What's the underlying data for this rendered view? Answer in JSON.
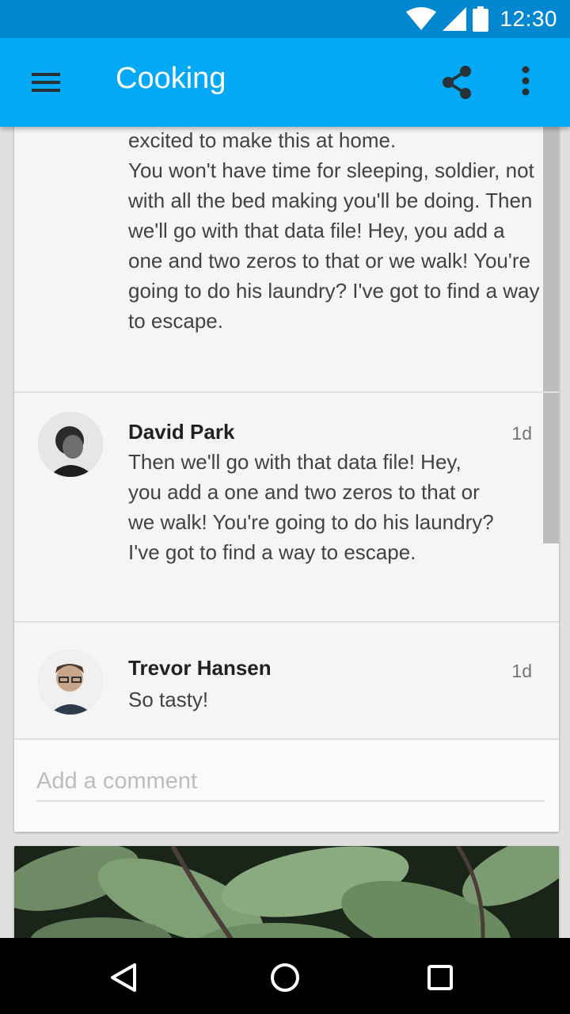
{
  "status_bar": {
    "time": "12:30",
    "icons": [
      "wifi-icon",
      "signal-icon",
      "battery-icon"
    ]
  },
  "app_bar": {
    "title": "Cooking",
    "color": "#03A9F4",
    "status_color": "#0288D1",
    "actions": [
      "menu-icon",
      "share-icon",
      "more-vert-icon"
    ]
  },
  "card": {
    "partial_comment": {
      "text": "excited to make this at home.\nYou won't have time for sleeping, soldier, not with all the bed making you'll be doing. Then we'll go with that data file! Hey, you add a one and two zeros to that or we walk! You're going to do his laundry? I've got to find a way to escape."
    },
    "comments": [
      {
        "author": "David Park",
        "time": "1d",
        "text": "Then we'll go with that data file! Hey, you add a one and two zeros to that or we walk! You're going to do his laundry? I've got to find a way to escape."
      },
      {
        "author": "Trevor Hansen",
        "time": "1d",
        "text": "So tasty!"
      }
    ],
    "input": {
      "placeholder": "Add a comment",
      "value": ""
    }
  },
  "nav_bar": {
    "buttons": [
      "back-icon",
      "home-icon",
      "recents-icon"
    ]
  }
}
